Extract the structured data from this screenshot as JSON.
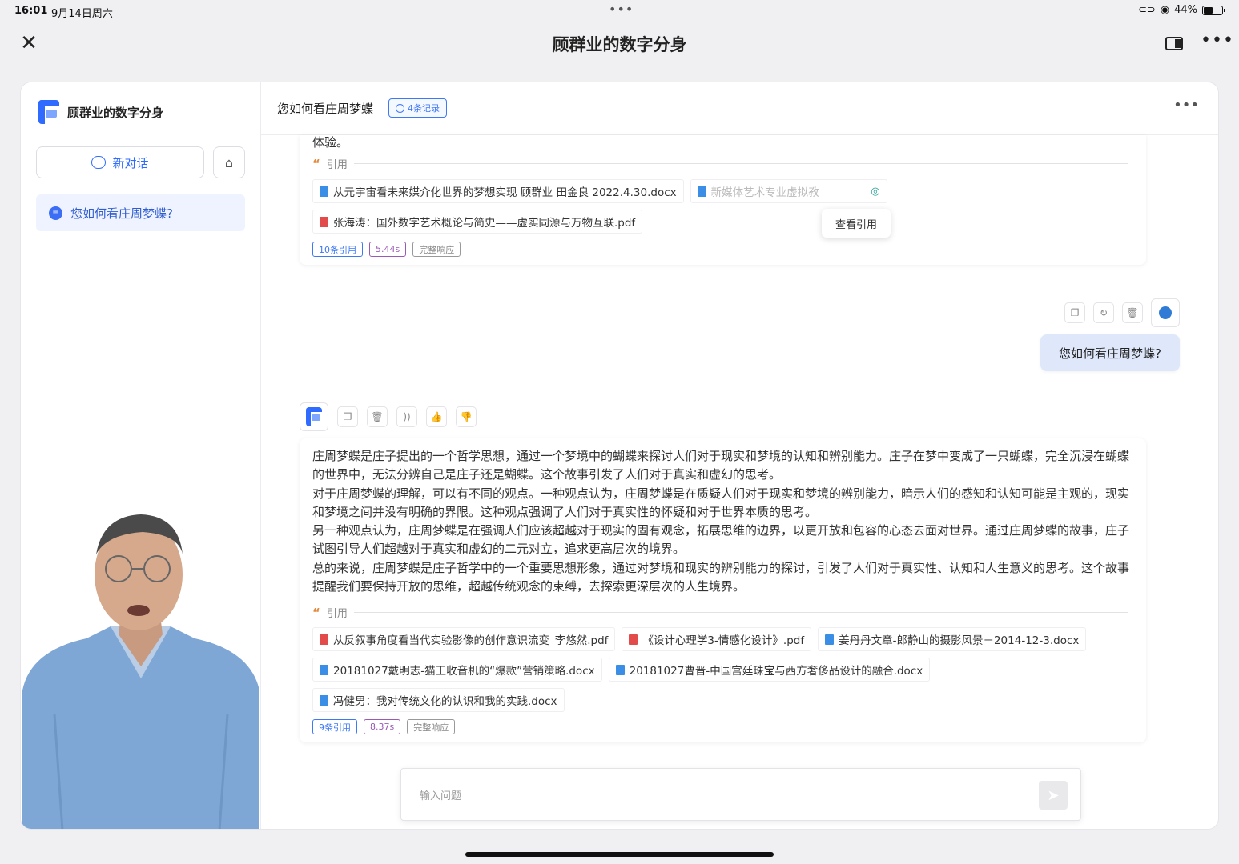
{
  "status_bar": {
    "time": "16:01",
    "date": "9月14日周六",
    "battery": "44%"
  },
  "app": {
    "title": "顾群业的数字分身"
  },
  "sidebar": {
    "brand": "顾群业的数字分身",
    "new_chat": "新对话",
    "history": [
      {
        "label": "您如何看庄周梦蝶?"
      }
    ]
  },
  "chat": {
    "title": "您如何看庄周梦蝶",
    "record_badge": "4条记录",
    "msg1": {
      "tail_text": "体验。",
      "cite_label": "引用",
      "citations": [
        {
          "name": "从元宇宙看未来媒介化世界的梦想实现 顾群业 田金良 2022.4.30.docx",
          "type": "docx"
        },
        {
          "name": "新媒体艺术专业虚拟教",
          "type": "docx"
        },
        {
          "name": "张海涛：国外数字艺术概论与简史——虚实同源与万物互联.pdf",
          "type": "pdf"
        }
      ],
      "tooltip": "查看引用",
      "tags": [
        "10条引用",
        "5.44s",
        "完整响应"
      ]
    },
    "user_msg": "您如何看庄周梦蝶?",
    "msg2": {
      "paragraphs": [
        "庄周梦蝶是庄子提出的一个哲学思想，通过一个梦境中的蝴蝶来探讨人们对于现实和梦境的认知和辨别能力。庄子在梦中变成了一只蝴蝶，完全沉浸在蝴蝶的世界中，无法分辨自己是庄子还是蝴蝶。这个故事引发了人们对于真实和虚幻的思考。",
        "对于庄周梦蝶的理解，可以有不同的观点。一种观点认为，庄周梦蝶是在质疑人们对于现实和梦境的辨别能力，暗示人们的感知和认知可能是主观的，现实和梦境之间并没有明确的界限。这种观点强调了人们对于真实性的怀疑和对于世界本质的思考。",
        "另一种观点认为，庄周梦蝶是在强调人们应该超越对于现实的固有观念，拓展思维的边界，以更开放和包容的心态去面对世界。通过庄周梦蝶的故事，庄子试图引导人们超越对于真实和虚幻的二元对立，追求更高层次的境界。",
        "总的来说，庄周梦蝶是庄子哲学中的一个重要思想形象，通过对梦境和现实的辨别能力的探讨，引发了人们对于真实性、认知和人生意义的思考。这个故事提醒我们要保持开放的思维，超越传统观念的束缚，去探索更深层次的人生境界。"
      ],
      "cite_label": "引用",
      "citations": [
        {
          "name": "从反叙事角度看当代实验影像的创作意识流变_李悠然.pdf",
          "type": "pdf"
        },
        {
          "name": "《设计心理学3-情感化设计》.pdf",
          "type": "pdf"
        },
        {
          "name": "姜丹丹文章-郎静山的摄影风景－2014-12-3.docx",
          "type": "docx"
        },
        {
          "name": "20181027戴明志-猫王收音机的“爆款”营销策略.docx",
          "type": "docx"
        },
        {
          "name": "20181027曹晋-中国宫廷珠宝与西方奢侈品设计的融合.docx",
          "type": "docx"
        },
        {
          "name": "冯健男：我对传统文化的认识和我的实践.docx",
          "type": "docx"
        }
      ],
      "tags": [
        "9条引用",
        "8.37s",
        "完整响应"
      ]
    },
    "input_placeholder": "输入问题"
  }
}
